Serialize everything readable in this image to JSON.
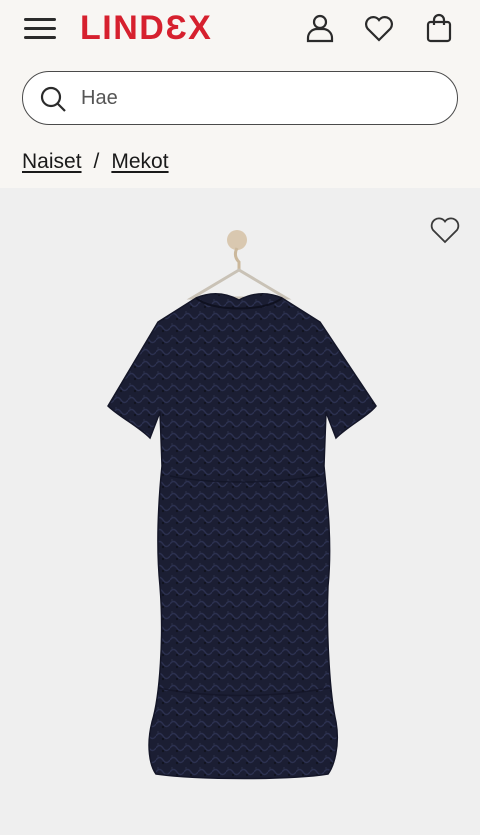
{
  "header": {
    "logo": "LINDƐX",
    "icons": [
      "menu-icon",
      "account-icon",
      "wishlist-heart-icon",
      "shopping-bag-icon"
    ]
  },
  "search": {
    "placeholder": "Hae",
    "value": ""
  },
  "breadcrumb": {
    "items": [
      "Naiset",
      "Mekot"
    ],
    "separator": "/"
  },
  "product": {
    "image": "navy-lace-dress-on-hanger",
    "wishlist_icon": "heart-outline-icon"
  },
  "colors": {
    "brand": "#d6202e",
    "background": "#f8f6f3",
    "image_background": "#efefef",
    "dress": "#1b1e33"
  }
}
